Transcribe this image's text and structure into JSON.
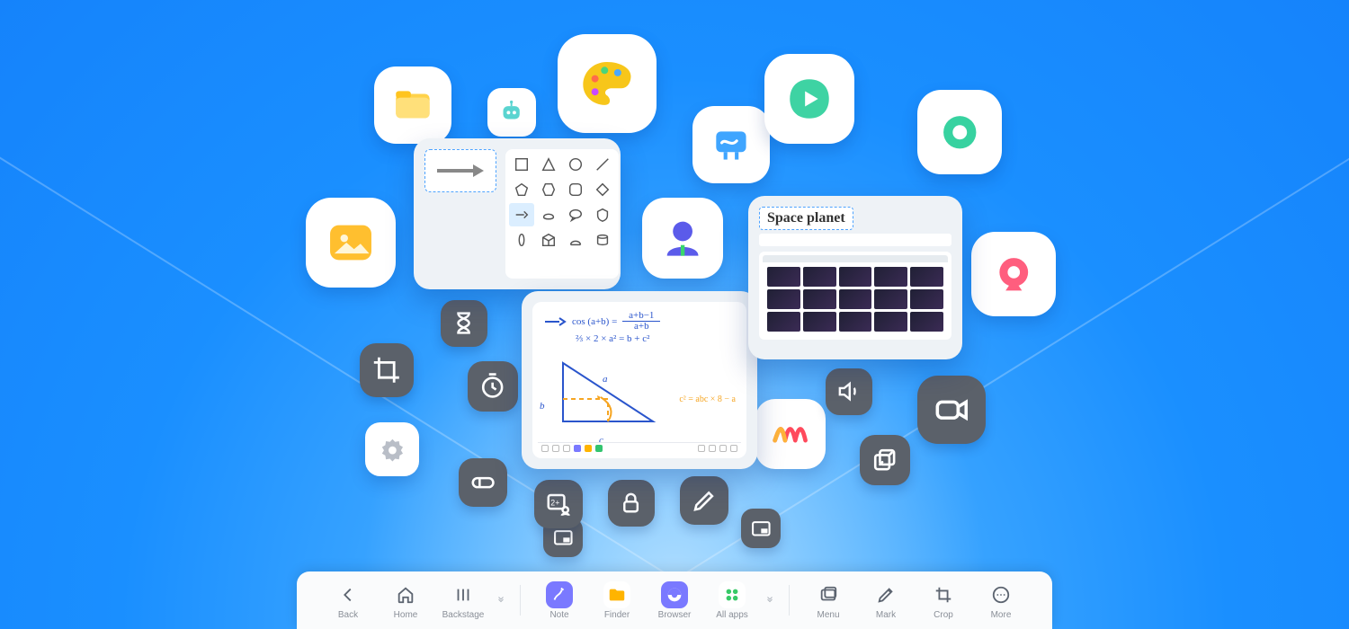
{
  "taskbar": {
    "back": "Back",
    "home": "Home",
    "backstage": "Backstage",
    "note": "Note",
    "finder": "Finder",
    "browser": "Browser",
    "allapps": "All apps",
    "menu": "Menu",
    "mark": "Mark",
    "crop": "Crop",
    "more": "More"
  },
  "browser_preview": {
    "title": "Space planet"
  },
  "math_preview": {
    "line1a": "cos (a+b) =",
    "line1_num": "a+b−1",
    "line1_den": "a+b",
    "line2": "⅔ × 2 × a² = b + c²",
    "label_a": "a",
    "label_b": "b",
    "label_c": "c",
    "eq2": "c² = abc × 8 − a"
  },
  "apps": {
    "files": "files-icon",
    "gallery": "gallery-icon",
    "robot": "robot-icon",
    "palette": "palette-icon",
    "whiteboard": "whiteboard-icon",
    "video": "video-icon",
    "camera_ring": "camera-ring-icon",
    "person": "person-icon",
    "webcam": "webcam-icon",
    "wave": "wave-icon",
    "settings": "settings-icon"
  },
  "tools": {
    "hourglass": "hourglass-icon",
    "crop": "crop-icon",
    "timer": "timer-icon",
    "switch": "switch-icon",
    "pip": "pip-icon",
    "teach": "teach-icon",
    "lock": "lock-icon",
    "pencil": "pencil-icon",
    "speaker": "speaker-icon",
    "duplicate": "duplicate-icon",
    "camcorder": "camcorder-icon"
  }
}
